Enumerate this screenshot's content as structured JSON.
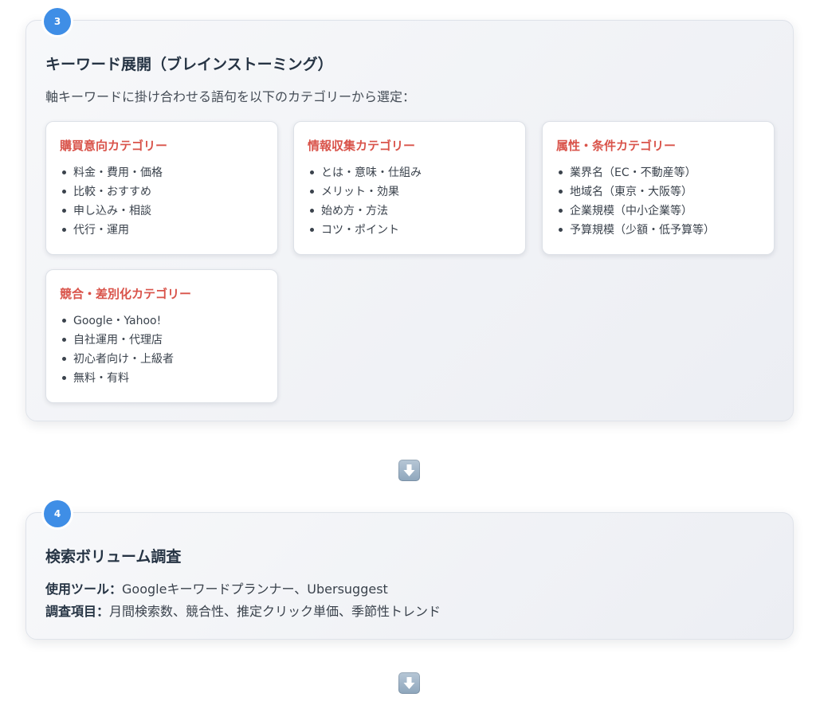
{
  "step3": {
    "badge": "3",
    "title": "キーワード展開（ブレインストーミング）",
    "description": "軸キーワードに掛け合わせる語句を以下のカテゴリーから選定：",
    "categories": [
      {
        "title": "購買意向カテゴリー",
        "items": [
          "料金・費用・価格",
          "比較・おすすめ",
          "申し込み・相談",
          "代行・運用"
        ]
      },
      {
        "title": "情報収集カテゴリー",
        "items": [
          "とは・意味・仕組み",
          "メリット・効果",
          "始め方・方法",
          "コツ・ポイント"
        ]
      },
      {
        "title": "属性・条件カテゴリー",
        "items": [
          "業界名（EC・不動産等）",
          "地域名（東京・大阪等）",
          "企業規模（中小企業等）",
          "予算規模（少額・低予算等）"
        ]
      },
      {
        "title": "競合・差別化カテゴリー",
        "items": [
          "Google・Yahoo!",
          "自社運用・代理店",
          "初心者向け・上級者",
          "無料・有料"
        ]
      }
    ]
  },
  "step4": {
    "badge": "4",
    "title": "検索ボリューム調査",
    "tools_label": "使用ツール：",
    "tools_value": "Googleキーワードプランナー、Ubersuggest",
    "items_label": "調査項目：",
    "items_value": "月間検索数、競合性、推定クリック単価、季節性トレンド"
  },
  "icons": {
    "arrow": "arrow-down-icon"
  },
  "colors": {
    "badge": "#3f8ee6",
    "category_title": "#d9534a",
    "step_title": "#263444"
  }
}
